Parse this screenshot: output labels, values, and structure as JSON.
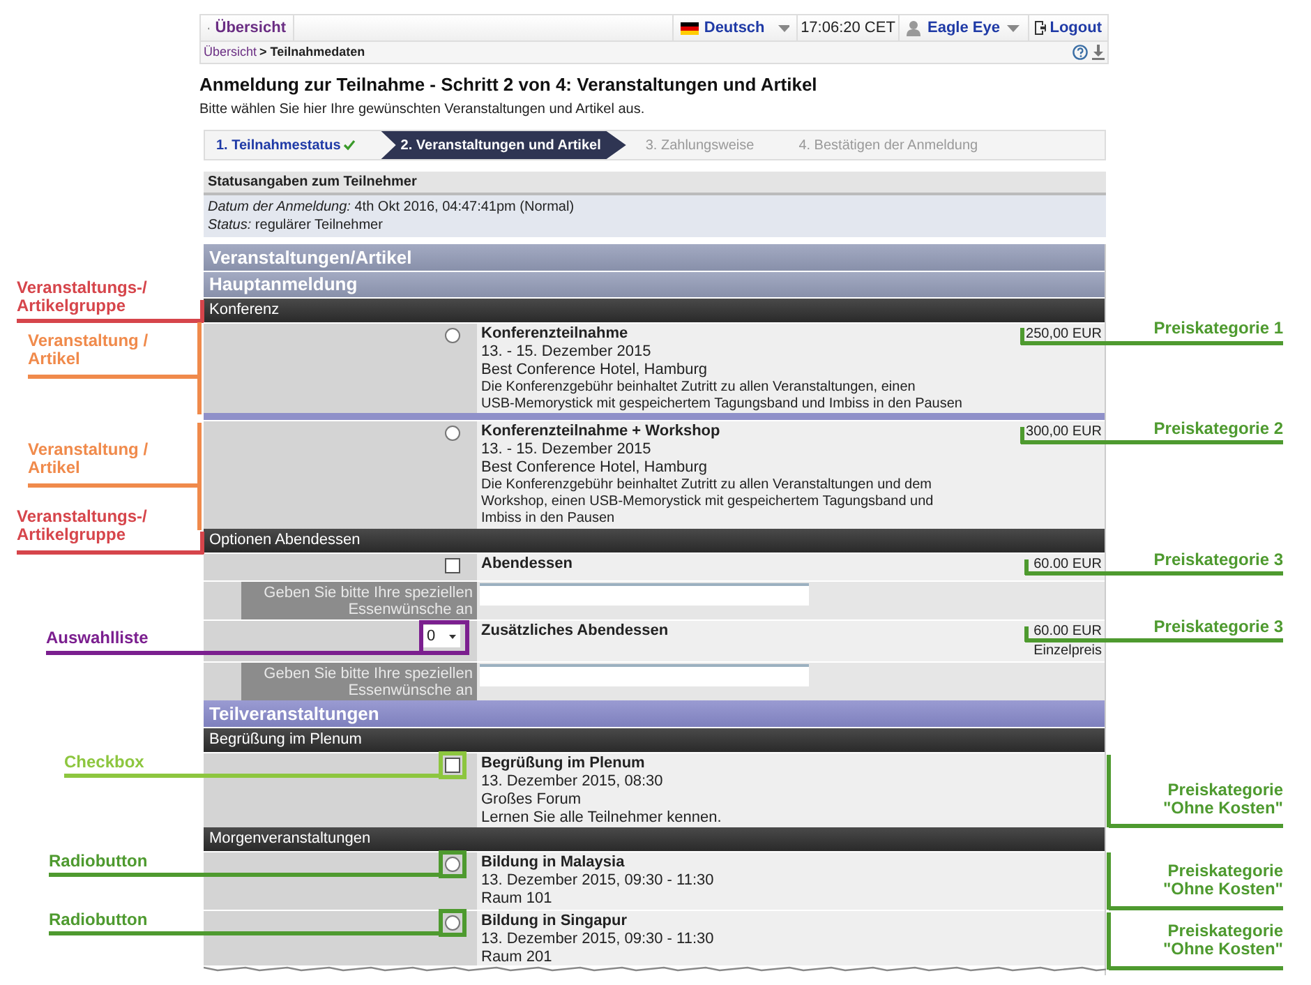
{
  "header": {
    "back_link": "Übersicht",
    "language": "Deutsch",
    "time": "17:06:20 CET",
    "user": "Eagle Eye",
    "logout": "Logout"
  },
  "breadcrumb": {
    "items": [
      "Übersicht",
      "Teilnahmedaten"
    ],
    "separator": ">"
  },
  "title": "Anmeldung zur Teilnahme - Schritt 2 von 4: Veranstaltungen und Artikel",
  "subtitle": "Bitte wählen Sie hier Ihre gewünschten Veranstaltungen und Artikel aus.",
  "steps": [
    {
      "label": "1. Teilnahmestatus",
      "selected": false,
      "done": true
    },
    {
      "label": "2. Veranstaltungen und Artikel",
      "selected": true,
      "done": false
    },
    {
      "label": "3. Zahlungsweise",
      "selected": false,
      "done": false
    },
    {
      "label": "4. Bestätigen der Anmeldung",
      "selected": false,
      "done": false
    }
  ],
  "status_box": {
    "title": "Statusangaben zum Teilnehmer",
    "lines": [
      {
        "label": "Datum der Anmeldung:",
        "value": "4th Okt 2016, 04:47:41pm (Normal)"
      },
      {
        "label": "Status:",
        "value": "regulärer Teilnehmer"
      }
    ]
  },
  "rows": [
    {
      "kind": "section",
      "title": "Veranstaltungen/Artikel"
    },
    {
      "kind": "section",
      "title": "Hauptanmeldung"
    },
    {
      "kind": "group",
      "title": "Konferenz"
    },
    {
      "kind": "item",
      "control": {
        "kind": "radio",
        "checked": false
      },
      "title": "Konferenzteilnahme",
      "lines": [
        "13. - 15. Dezember 2015",
        "Best Conference Hotel, Hamburg"
      ],
      "description": [
        "Die Konferenzgebühr beinhaltet Zutritt zu allen Veranstaltungen, einen",
        "USB-Memorystick mit gespeichertem Tagungsband und Imbiss in den Pausen"
      ],
      "price": "250,00 EUR"
    },
    {
      "kind": "divider"
    },
    {
      "kind": "item",
      "control": {
        "kind": "radio",
        "checked": false
      },
      "title": "Konferenzteilnahme + Workshop",
      "lines": [
        "13. - 15. Dezember 2015",
        "Best Conference Hotel, Hamburg"
      ],
      "description": [
        "Die Konferenzgebühr beinhaltet Zutritt zu allen Veranstaltungen und dem",
        "Workshop, einen USB-Memorystick mit gespeichertem Tagungsband und",
        "Imbiss in den Pausen"
      ],
      "price": "300,00 EUR"
    },
    {
      "kind": "group",
      "title": "Optionen Abendessen"
    },
    {
      "kind": "item",
      "control": {
        "kind": "checkbox",
        "checked": false
      },
      "title": "Abendessen",
      "price": "60.00 EUR"
    },
    {
      "kind": "wish",
      "label": "Geben Sie bitte Ihre speziellen Essenwünsche an"
    },
    {
      "kind": "item",
      "control": {
        "kind": "select",
        "value": "0"
      },
      "title": "Zusätzliches Abendessen",
      "price": "60.00 EUR",
      "price_note": "Einzelpreis"
    },
    {
      "kind": "wish",
      "label": "Geben Sie bitte Ihre speziellen Essenwünsche an"
    },
    {
      "kind": "subsection",
      "title": "Teilveranstaltungen"
    },
    {
      "kind": "group",
      "title": "Begrüßung im Plenum"
    },
    {
      "kind": "item",
      "control": {
        "kind": "checkbox",
        "checked": false
      },
      "title": "Begrüßung im Plenum",
      "lines": [
        "13. Dezember 2015, 08:30",
        "Großes Forum",
        "Lernen Sie alle Teilnehmer kennen."
      ]
    },
    {
      "kind": "group",
      "title": "Morgenveranstaltungen"
    },
    {
      "kind": "item",
      "control": {
        "kind": "radio",
        "checked": false
      },
      "title": "Bildung in Malaysia",
      "lines": [
        "13. Dezember 2015, 09:30 - 11:30",
        "Raum 101"
      ]
    },
    {
      "kind": "item",
      "control": {
        "kind": "radio",
        "checked": false
      },
      "title": "Bildung in Singapur",
      "lines": [
        "13. Dezember 2015, 09:30 - 11:30",
        "Raum 201"
      ]
    }
  ],
  "left_annotations": [
    {
      "lines": [
        "Veranstaltungs-/",
        "Artikelgruppe"
      ],
      "color": "#d6454b"
    },
    {
      "lines": [
        "Veranstaltung /",
        "Artikel"
      ],
      "color": "#f08a4b"
    },
    {
      "lines": [
        "Veranstaltung /",
        "Artikel"
      ],
      "color": "#f08a4b"
    },
    {
      "lines": [
        "Veranstaltungs-/",
        "Artikelgruppe"
      ],
      "color": "#d6454b"
    },
    {
      "lines": [
        "Auswahlliste"
      ],
      "color": "#7b1f8f"
    },
    {
      "lines": [
        "Checkbox"
      ],
      "color": "#8dc63f"
    },
    {
      "lines": [
        "Radiobutton"
      ],
      "color": "#4e9a2f"
    },
    {
      "lines": [
        "Radiobutton"
      ],
      "color": "#4e9a2f"
    }
  ],
  "right_annotations": [
    {
      "lines": [
        "Preiskategorie 1"
      ],
      "color": "#4e9a2f"
    },
    {
      "lines": [
        "Preiskategorie 2"
      ],
      "color": "#4e9a2f"
    },
    {
      "lines": [
        "Preiskategorie 3"
      ],
      "color": "#4e9a2f"
    },
    {
      "lines": [
        "Preiskategorie 3"
      ],
      "color": "#4e9a2f"
    },
    {
      "lines": [
        "Preiskategorie",
        "\"Ohne Kosten\""
      ],
      "color": "#4e9a2f"
    },
    {
      "lines": [
        "Preiskategorie",
        "\"Ohne Kosten\""
      ],
      "color": "#4e9a2f"
    },
    {
      "lines": [
        "Preiskategorie",
        "\"Ohne Kosten\""
      ],
      "color": "#4e9a2f"
    }
  ]
}
